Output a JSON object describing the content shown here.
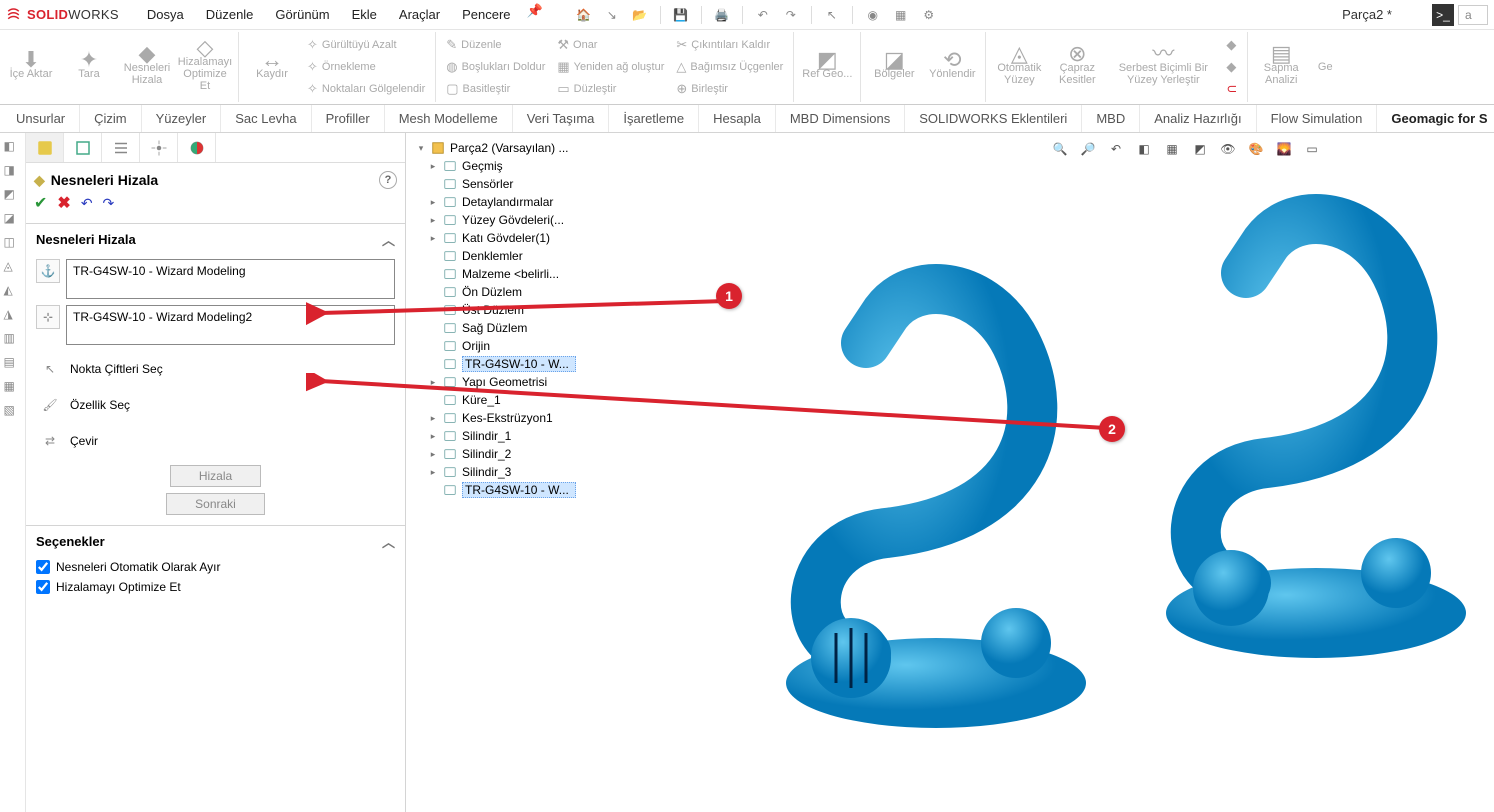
{
  "logo": {
    "brand": "SOLID",
    "brand2": "WORKS"
  },
  "menu": [
    "Dosya",
    "Düzenle",
    "Görünüm",
    "Ekle",
    "Araçlar",
    "Pencere"
  ],
  "document_title": "Parça2 *",
  "search_placeholder": "a",
  "ribbon": {
    "large": [
      {
        "label": "İçe\nAktar"
      },
      {
        "label": "Tara"
      },
      {
        "label": "Nesneleri\nHizala"
      },
      {
        "label": "Hizalamayı\nOptimize Et"
      },
      {
        "label": "Kaydır"
      }
    ],
    "stacks": [
      [
        "Gürültüyü Azalt",
        "Örnekleme",
        "Noktaları Gölgelendir"
      ],
      [
        "Düzenle",
        "Boşlukları Doldur",
        "Basitleştir"
      ],
      [
        "Onar",
        "Yeniden ağ oluştur",
        "Düzleştir"
      ],
      [
        "Çıkıntıları Kaldır",
        "Bağımsız Üçgenler",
        "Birleştir"
      ]
    ],
    "large2": [
      {
        "label": "Ref Geo..."
      },
      {
        "label": "Bölgeler"
      },
      {
        "label": "Yönlendir"
      },
      {
        "label": "Otomatik\nYüzey"
      },
      {
        "label": "Çapraz\nKesitler"
      },
      {
        "label": "Serbest Biçimli Bir\nYüzey Yerleştir"
      }
    ],
    "tail_stack": [
      "",
      "",
      ""
    ],
    "tail_large": [
      {
        "label": "Sapma\nAnalizi"
      },
      {
        "label": "Ge"
      }
    ]
  },
  "cm_tabs": [
    "Unsurlar",
    "Çizim",
    "Yüzeyler",
    "Sac Levha",
    "Profiller",
    "Mesh Modelleme",
    "Veri Taşıma",
    "İşaretleme",
    "Hesapla",
    "MBD Dimensions",
    "SOLIDWORKS Eklentileri",
    "MBD",
    "Analiz Hazırlığı",
    "Flow Simulation",
    "Geomagic for S"
  ],
  "cm_active": "Geomagic for S",
  "pm": {
    "title": "Nesneleri Hizala",
    "section": "Nesneleri Hizala",
    "selection1": "TR-G4SW-10 - Wizard Modeling",
    "selection2": "TR-G4SW-10 - Wizard Modeling2",
    "point_pairs": "Nokta Çiftleri Seç",
    "feature_sel": "Özellik Seç",
    "flip": "Çevir",
    "btn_align": "Hizala",
    "btn_next": "Sonraki",
    "options_title": "Seçenekler",
    "chk1": "Nesneleri Otomatik Olarak Ayır",
    "chk2": "Hizalamayı Optimize Et"
  },
  "tree": {
    "root": "Parça2 (Varsayılan) ...",
    "items": [
      {
        "exp": "▸",
        "label": "Geçmiş"
      },
      {
        "exp": "",
        "label": "Sensörler"
      },
      {
        "exp": "▸",
        "label": "Detaylandırmalar"
      },
      {
        "exp": "▸",
        "label": "Yüzey Gövdeleri(..."
      },
      {
        "exp": "▸",
        "label": "Katı Gövdeler(1)"
      },
      {
        "exp": "",
        "label": "Denklemler"
      },
      {
        "exp": "",
        "label": "Malzeme <belirli..."
      },
      {
        "exp": "",
        "label": "Ön Düzlem"
      },
      {
        "exp": "",
        "label": "Üst Düzlem"
      },
      {
        "exp": "",
        "label": "Sağ Düzlem"
      },
      {
        "exp": "",
        "label": "Orijin"
      },
      {
        "exp": "",
        "label": "TR-G4SW-10 - W...",
        "selected": true
      },
      {
        "exp": "▸",
        "label": "Yapı Geometrisi"
      },
      {
        "exp": "",
        "label": "Küre_1"
      },
      {
        "exp": "▸",
        "label": "Kes-Ekstrüzyon1"
      },
      {
        "exp": "▸",
        "label": "Silindir_1"
      },
      {
        "exp": "▸",
        "label": "Silindir_2"
      },
      {
        "exp": "▸",
        "label": "Silindir_3"
      },
      {
        "exp": "",
        "label": "TR-G4SW-10 - W...",
        "selected": true
      }
    ]
  },
  "callouts": {
    "a": "1",
    "b": "2"
  }
}
